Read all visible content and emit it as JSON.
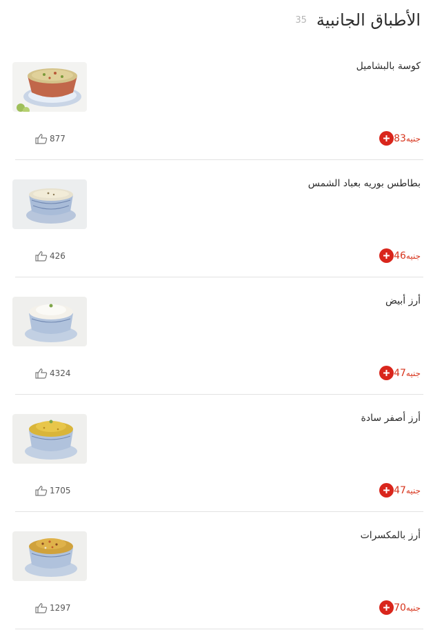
{
  "section": {
    "title": "الأطباق الجانبية",
    "count": "35"
  },
  "colors": {
    "accent": "#d9261c",
    "price_text": "#d7341c",
    "divider": "#e2e2e2"
  },
  "items": [
    {
      "name": "كوسة بالبشاميل",
      "price": "83",
      "currency": "جنيه",
      "likes": "877",
      "image_icon": "zucchini-bechamel-bowl-image"
    },
    {
      "name": "بطاطس بوريه بعباد الشمس",
      "price": "46",
      "currency": "جنيه",
      "likes": "426",
      "image_icon": "mashed-potato-bowl-image"
    },
    {
      "name": "أرز أبيض",
      "price": "47",
      "currency": "جنيه",
      "likes": "4324",
      "image_icon": "white-rice-bowl-image"
    },
    {
      "name": "أرز أصفر سادة",
      "price": "47",
      "currency": "جنيه",
      "likes": "1705",
      "image_icon": "yellow-rice-bowl-image"
    },
    {
      "name": "أرز بالمكسرات",
      "price": "70",
      "currency": "جنيه",
      "likes": "1297",
      "image_icon": "nut-rice-bowl-image"
    }
  ]
}
